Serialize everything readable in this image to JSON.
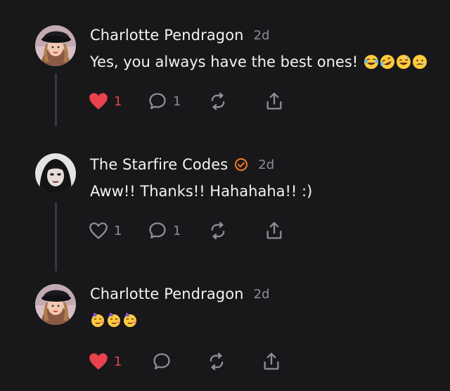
{
  "colors": {
    "background": "#18181b",
    "text": "#f3f3f3",
    "muted": "#8e8e93",
    "like_active": "#e9424c",
    "verified": "#ff7a1a",
    "thread_line": "#3a3a3e"
  },
  "posts": [
    {
      "author": "Charlotte Pendragon",
      "time": "2d",
      "text": "Yes, you always have the best ones!",
      "emojis": [
        "rolling-laughing-emoji",
        "rofl-emoji",
        "sweat-smile-emoji",
        "tear-smile-emoji"
      ],
      "liked": true,
      "likes": "1",
      "replies": "1",
      "reposts": "",
      "verified": false
    },
    {
      "author": "The Starfire Codes",
      "time": "2d",
      "text": "Aww!! Thanks!! Hahahaha!! :)",
      "emojis": [],
      "liked": false,
      "likes": "1",
      "replies": "1",
      "reposts": "",
      "verified": true
    },
    {
      "author": "Charlotte Pendragon",
      "time": "2d",
      "text": "",
      "emojis": [
        "partying-face-emoji",
        "partying-face-emoji",
        "partying-face-emoji"
      ],
      "liked": true,
      "likes": "1",
      "replies": "",
      "reposts": "",
      "verified": false
    }
  ]
}
